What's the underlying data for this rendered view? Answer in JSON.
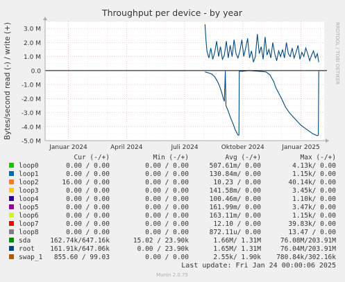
{
  "chart_data": {
    "type": "line",
    "title": "Throughput per device - by year",
    "ylabel": "Bytes/second read (-) / write (+)",
    "side_label": "RRDTOOL / TOBI OETIKER",
    "ylim": [
      -5.0,
      3.5
    ],
    "yticks": [
      3.0,
      2.0,
      1.0,
      0.0,
      -1.0,
      -2.0,
      -3.0,
      -4.0,
      -5.0
    ],
    "ytick_labels": [
      "3.0 M",
      "2.0 M",
      "1.0 M",
      "0.0",
      "-1.0 M",
      "-2.0 M",
      "-3.0 M",
      "-4.0 M",
      "-5.0 M"
    ],
    "xrange_months": [
      -1.2,
      13.2
    ],
    "xticks": [
      {
        "label": "Januar 2024",
        "month": 0
      },
      {
        "label": "April 2024",
        "month": 3
      },
      {
        "label": "Juli 2024",
        "month": 6
      },
      {
        "label": "Oktober 2024",
        "month": 9
      },
      {
        "label": "Januar 2025",
        "month": 12
      }
    ],
    "grid": true,
    "columns": {
      "cur": "Cur (-/+)",
      "min": "Min (-/+)",
      "avg": "Avg (-/+)",
      "max": "Max (-/+)"
    },
    "series": [
      {
        "name": "loop0",
        "color": "#00cc00",
        "cur": "0.00 /  0.00",
        "min": "0.00 /  0.00",
        "avg": "507.61m/  0.00",
        "max": "4.13k/  0.00"
      },
      {
        "name": "loop1",
        "color": "#0066b3",
        "cur": "0.00 /  0.00",
        "min": "0.00 /  0.00",
        "avg": "130.84m/  0.00",
        "max": "1.15k/  0.00"
      },
      {
        "name": "loop2",
        "color": "#ff8000",
        "cur": "16.00 /  0.00",
        "min": "0.00 /  0.00",
        "avg": "10.23 /  0.00",
        "max": "40.14k/  0.00"
      },
      {
        "name": "loop3",
        "color": "#ffcc00",
        "cur": "0.00 /  0.00",
        "min": "0.00 /  0.00",
        "avg": "141.58m/  0.00",
        "max": "3.45k/  0.00"
      },
      {
        "name": "loop4",
        "color": "#330099",
        "cur": "0.00 /  0.00",
        "min": "0.00 /  0.00",
        "avg": "100.46m/  0.00",
        "max": "1.10k/  0.00"
      },
      {
        "name": "loop5",
        "color": "#990099",
        "cur": "0.00 /  0.00",
        "min": "0.00 /  0.00",
        "avg": "161.99m/  0.00",
        "max": "3.47k/  0.00"
      },
      {
        "name": "loop6",
        "color": "#ccff00",
        "cur": "0.00 /  0.00",
        "min": "0.00 /  0.00",
        "avg": "163.11m/  0.00",
        "max": "1.15k/  0.00"
      },
      {
        "name": "loop7",
        "color": "#ff0000",
        "cur": "0.00 /  0.00",
        "min": "0.00 /  0.00",
        "avg": "12.10 /  0.00",
        "max": "39.83k/  0.00"
      },
      {
        "name": "loop8",
        "color": "#808080",
        "cur": "0.00 /  0.00",
        "min": "0.00 /  0.00",
        "avg": "872.11u/  0.00",
        "max": "13.47 /  0.00"
      },
      {
        "name": "sda",
        "color": "#008f00",
        "cur": "162.74k/647.16k",
        "min": "15.02 / 23.90k",
        "avg": "1.66M/  1.31M",
        "max": "76.08M/203.91M"
      },
      {
        "name": "root",
        "color": "#00487d",
        "cur": "161.91k/647.06k",
        "min": "0.00 / 23.90k",
        "avg": "1.65M/  1.31M",
        "max": "76.04M/203.91M"
      },
      {
        "name": "swap_1",
        "color": "#b35a00",
        "cur": "855.60 / 99.03",
        "min": "0.00 /  0.00",
        "avg": "2.55k/  1.90k",
        "max": "780.84k/302.16k"
      }
    ],
    "plotted": {
      "write_points": [
        [
          7.05,
          3.3
        ],
        [
          7.1,
          2.2
        ],
        [
          7.15,
          1.4
        ],
        [
          7.25,
          0.9
        ],
        [
          7.35,
          1.6
        ],
        [
          7.45,
          0.8
        ],
        [
          7.55,
          1.3
        ],
        [
          7.65,
          2.1
        ],
        [
          7.75,
          1.0
        ],
        [
          7.85,
          1.7
        ],
        [
          7.95,
          0.8
        ],
        [
          8.05,
          1.1
        ],
        [
          8.15,
          2.1
        ],
        [
          8.25,
          0.9
        ],
        [
          8.35,
          1.8
        ],
        [
          8.45,
          1.0
        ],
        [
          8.55,
          2.2
        ],
        [
          8.65,
          1.2
        ],
        [
          8.75,
          0.9
        ],
        [
          8.85,
          1.4
        ],
        [
          8.95,
          2.2
        ],
        [
          9.05,
          1.0
        ],
        [
          9.15,
          1.6
        ],
        [
          9.25,
          2.3
        ],
        [
          9.35,
          0.9
        ],
        [
          9.45,
          1.4
        ],
        [
          9.55,
          0.6
        ],
        [
          9.65,
          1.0
        ],
        [
          9.75,
          2.6
        ],
        [
          9.85,
          1.2
        ],
        [
          9.95,
          1.7
        ],
        [
          10.05,
          0.8
        ],
        [
          10.15,
          2.4
        ],
        [
          10.25,
          1.1
        ],
        [
          10.35,
          1.5
        ],
        [
          10.45,
          0.9
        ],
        [
          10.55,
          2.0
        ],
        [
          10.65,
          1.2
        ],
        [
          10.75,
          0.7
        ],
        [
          10.85,
          1.4
        ],
        [
          10.95,
          1.0
        ],
        [
          11.05,
          1.5
        ],
        [
          11.15,
          0.9
        ],
        [
          11.25,
          2.0
        ],
        [
          11.35,
          1.2
        ],
        [
          11.45,
          1.0
        ],
        [
          11.55,
          1.6
        ],
        [
          11.65,
          0.9
        ],
        [
          11.75,
          1.3
        ],
        [
          11.85,
          1.8
        ],
        [
          11.95,
          0.8
        ],
        [
          12.05,
          1.3
        ],
        [
          12.15,
          1.0
        ],
        [
          12.25,
          1.6
        ],
        [
          12.35,
          1.2
        ],
        [
          12.45,
          0.7
        ],
        [
          12.55,
          1.1
        ],
        [
          12.65,
          1.4
        ],
        [
          12.75,
          0.9
        ],
        [
          12.85,
          1.2
        ],
        [
          12.92,
          0.6
        ]
      ],
      "read_points": [
        [
          7.05,
          -0.1
        ],
        [
          7.2,
          -0.15
        ],
        [
          7.4,
          -0.25
        ],
        [
          7.55,
          -0.45
        ],
        [
          7.7,
          -0.8
        ],
        [
          7.8,
          -1.1
        ],
        [
          7.9,
          -1.5
        ],
        [
          8.0,
          -2.0
        ],
        [
          8.05,
          -2.2
        ],
        [
          8.1,
          -0.05
        ],
        [
          8.13,
          -2.5
        ],
        [
          8.25,
          -2.9
        ],
        [
          8.35,
          -3.3
        ],
        [
          8.5,
          -3.8
        ],
        [
          8.6,
          -4.2
        ],
        [
          8.75,
          -4.6
        ],
        [
          8.8,
          -4.6
        ],
        [
          8.82,
          -0.05
        ],
        [
          9.0,
          -0.05
        ],
        [
          9.3,
          -0.0
        ],
        [
          9.8,
          -0.05
        ],
        [
          10.2,
          -0.1
        ],
        [
          10.4,
          -0.3
        ],
        [
          10.6,
          -0.8
        ],
        [
          10.7,
          -1.2
        ],
        [
          10.85,
          -1.6
        ],
        [
          11.0,
          -2.0
        ],
        [
          11.2,
          -2.6
        ],
        [
          11.4,
          -3.0
        ],
        [
          11.6,
          -3.3
        ],
        [
          11.8,
          -3.6
        ],
        [
          12.0,
          -3.9
        ],
        [
          12.2,
          -4.1
        ],
        [
          12.4,
          -4.3
        ],
        [
          12.6,
          -4.5
        ],
        [
          12.85,
          -4.65
        ],
        [
          12.9,
          -4.6
        ],
        [
          12.92,
          -0.05
        ]
      ]
    }
  },
  "footer": {
    "last_update": "Last update: Fri Jan 24 00:00:06 2025",
    "munin_version": "Munin 2.0.75"
  }
}
